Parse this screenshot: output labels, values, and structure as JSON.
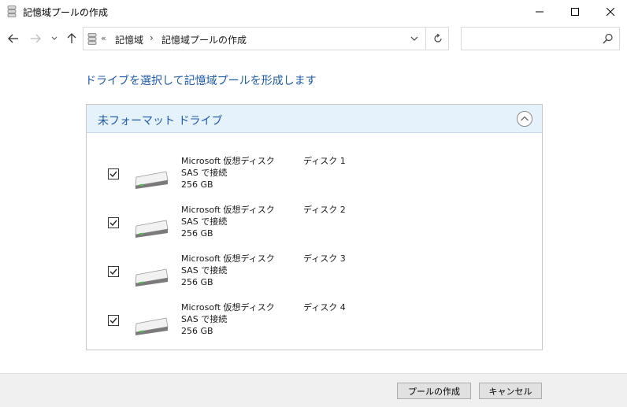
{
  "window": {
    "title": "記憶域プールの作成"
  },
  "address": {
    "overflow": "«",
    "crumb1": "記憶域",
    "separator": "›",
    "crumb2": "記憶域プールの作成"
  },
  "search": {
    "placeholder": ""
  },
  "main": {
    "heading": "ドライブを選択して記憶域プールを形成します"
  },
  "panel": {
    "title": "未フォーマット ドライブ",
    "drives": [
      {
        "name": "Microsoft 仮想ディスク",
        "connection": "SAS で接続",
        "size": "256 GB",
        "disk": "ディスク 1",
        "checked": true
      },
      {
        "name": "Microsoft 仮想ディスク",
        "connection": "SAS で接続",
        "size": "256 GB",
        "disk": "ディスク 2",
        "checked": true
      },
      {
        "name": "Microsoft 仮想ディスク",
        "connection": "SAS で接続",
        "size": "256 GB",
        "disk": "ディスク 3",
        "checked": true
      },
      {
        "name": "Microsoft 仮想ディスク",
        "connection": "SAS で接続",
        "size": "256 GB",
        "disk": "ディスク 4",
        "checked": true
      }
    ]
  },
  "footer": {
    "create_label": "プールの作成",
    "cancel_label": "キャンセル"
  },
  "icons": {
    "title": "storage-pool-icon",
    "back": "arrow-left-icon",
    "forward": "arrow-right-icon",
    "recent": "chevron-down-icon",
    "up": "arrow-up-icon",
    "refresh": "refresh-icon",
    "search": "search-icon",
    "collapse": "chevron-up-circle-icon",
    "drive": "hard-drive-icon",
    "check": "checkmark-icon"
  },
  "colors": {
    "accent": "#1e5aa8",
    "panel_header": "#e5f1fb",
    "footer": "#f0f0f0"
  }
}
